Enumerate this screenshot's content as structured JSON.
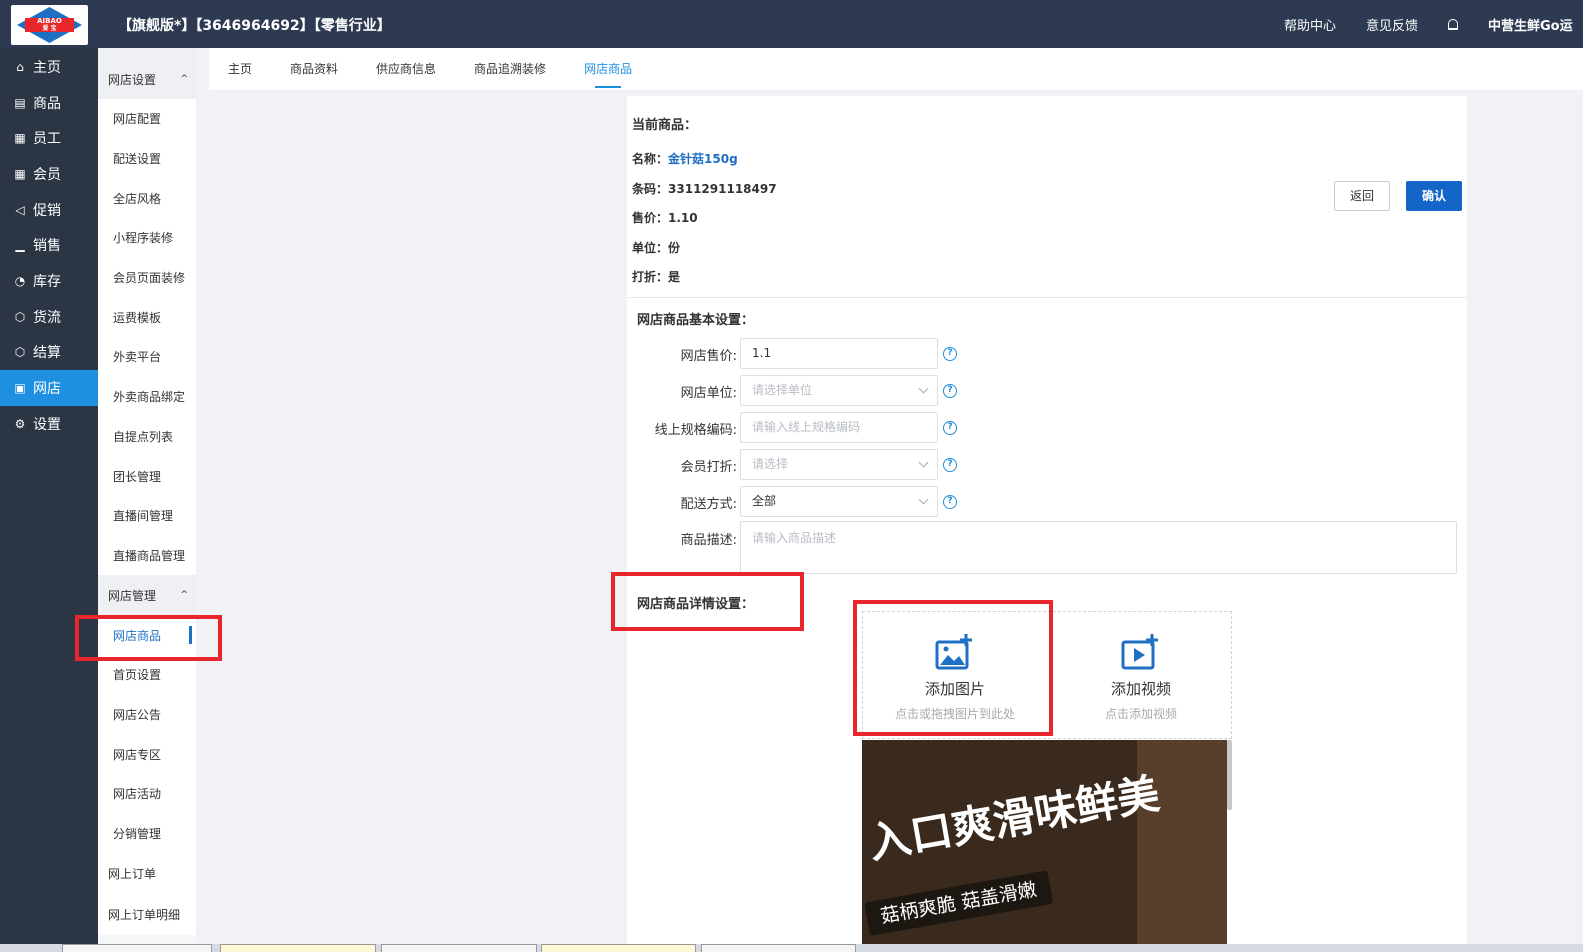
{
  "header": {
    "title": "【旗舰版*】【3646964692】【零售行业】",
    "help_center": "帮助中心",
    "feedback": "意见反馈",
    "user": "中营生鲜Go运",
    "logo_text_top": "AIBAO",
    "logo_text_bottom": "爱 宝"
  },
  "leftnav": {
    "items": [
      {
        "label": "主页",
        "icon": "home-icon",
        "glyph": "⌂"
      },
      {
        "label": "商品",
        "icon": "goods-icon",
        "glyph": "▤"
      },
      {
        "label": "员工",
        "icon": "staff-icon",
        "glyph": "▦"
      },
      {
        "label": "会员",
        "icon": "member-icon",
        "glyph": "▦"
      },
      {
        "label": "促销",
        "icon": "promotion-icon",
        "glyph": "◁"
      },
      {
        "label": "销售",
        "icon": "sales-chart-icon",
        "glyph": "▁"
      },
      {
        "label": "库存",
        "icon": "inventory-pie-icon",
        "glyph": "◔"
      },
      {
        "label": "货流",
        "icon": "logistics-cube-icon",
        "glyph": "⬡"
      },
      {
        "label": "结算",
        "icon": "settlement-cube-icon",
        "glyph": "⬡"
      },
      {
        "label": "网店",
        "icon": "online-store-gift-icon",
        "glyph": "▣",
        "active": true
      },
      {
        "label": "设置",
        "icon": "settings-gear-icon",
        "glyph": "⚙"
      }
    ]
  },
  "submenu": {
    "group1": "网店设置",
    "group1_items": [
      "网店配置",
      "配送设置",
      "全店风格",
      "小程序装修",
      "会员页面装修",
      "运费模板",
      "外卖平台",
      "外卖商品绑定",
      "自提点列表",
      "团长管理",
      "直播间管理",
      "直播商品管理"
    ],
    "group2": "网店管理",
    "group2_items": [
      "网店商品",
      "首页设置",
      "网店公告",
      "网店专区",
      "网店活动",
      "分销管理"
    ],
    "group2_active": "网店商品",
    "plain_items": [
      "网上订单",
      "网上订单明细"
    ]
  },
  "tabs": [
    {
      "label": "主页"
    },
    {
      "label": "商品资料"
    },
    {
      "label": "供应商信息"
    },
    {
      "label": "商品追溯装修"
    },
    {
      "label": "网店商品",
      "active": true
    }
  ],
  "current": {
    "title": "当前商品：",
    "name_label": "名称：",
    "name": "金针菇150g",
    "barcode_label": "条码：",
    "barcode": "3311291118497",
    "price_label": "售价：",
    "price": "1.10",
    "unit_label": "单位：",
    "unit": "份",
    "discount_label": "打折：",
    "discount": "是"
  },
  "actions": {
    "back": "返回",
    "confirm": "确认"
  },
  "basic": {
    "title": "网店商品基本设置：",
    "price_label": "网店售价:",
    "price_value": "1.1",
    "unit_label": "网店单位:",
    "unit_placeholder": "请选择单位",
    "spec_label": "线上规格编码:",
    "spec_placeholder": "请输入线上规格编码",
    "member_label": "会员打折:",
    "member_placeholder": "请选择",
    "delivery_label": "配送方式:",
    "delivery_value": "全部",
    "desc_label": "商品描述:",
    "desc_placeholder": "请输入商品描述"
  },
  "detail": {
    "title": "网店商品详情设置：",
    "add_image": "添加图片",
    "add_image_hint": "点击或拖拽图片到此处",
    "add_video": "添加视频",
    "add_video_hint": "点击添加视频",
    "banner_main": "入口爽滑味鲜美",
    "banner_sub": "菇柄爽脆 菇盖滑嫩"
  },
  "colors": {
    "topbar": "#2e3a52",
    "leftnav": "#2b3544",
    "accent": "#1f8fe0",
    "confirm_button": "#1366c8",
    "highlight_red": "#e8262b"
  }
}
